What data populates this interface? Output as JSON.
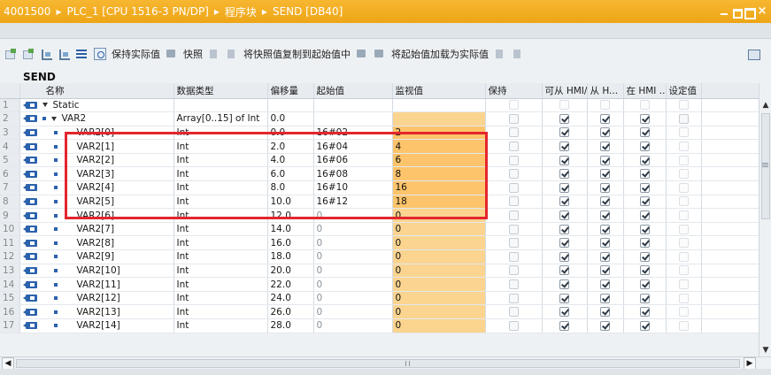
{
  "title": {
    "project": "4001500",
    "device": "PLC_1 [CPU 1516-3 PN/DP]",
    "folder": "程序块",
    "block": "SEND [DB40]",
    "separator": "▸"
  },
  "toolbar": {
    "keep_actual": "保持实际值",
    "snapshot": "快照",
    "copy_snapshot": "将快照值复制到起始值中",
    "load_start": "将起始值加载为实际值"
  },
  "block_name": "SEND",
  "headers": {
    "name": "名称",
    "datatype": "数据类型",
    "offset": "偏移量",
    "start": "起始值",
    "monitor": "监视值",
    "retain": "保持",
    "hmi_access": "可从 HMI/O...",
    "hmi_from": "从 H...",
    "hmi_in": "在 HMI ...",
    "setpoint": "设定值"
  },
  "rows": [
    {
      "num": "1",
      "kind": "static",
      "name": "Static",
      "datatype": "",
      "offset": "",
      "start": "",
      "monitor": "",
      "retain": "faint",
      "hmi": [
        "faint",
        "faint",
        "faint"
      ],
      "setpoint": "faint"
    },
    {
      "num": "2",
      "kind": "array",
      "name": "VAR2",
      "datatype": "Array[0..15] of Int",
      "offset": "0.0",
      "start": "",
      "monitor": "",
      "retain": "off",
      "hmi": [
        "on",
        "on",
        "on"
      ],
      "setpoint": "off"
    },
    {
      "num": "3",
      "kind": "elem",
      "name": "VAR2[0]",
      "datatype": "Int",
      "offset": "0.0",
      "start": "16#02",
      "monitor": "2",
      "retain": "off",
      "hmi": [
        "on",
        "on",
        "on"
      ],
      "setpoint": "faint"
    },
    {
      "num": "4",
      "kind": "elem",
      "name": "VAR2[1]",
      "datatype": "Int",
      "offset": "2.0",
      "start": "16#04",
      "monitor": "4",
      "retain": "off",
      "hmi": [
        "on",
        "on",
        "on"
      ],
      "setpoint": "faint"
    },
    {
      "num": "5",
      "kind": "elem",
      "name": "VAR2[2]",
      "datatype": "Int",
      "offset": "4.0",
      "start": "16#06",
      "monitor": "6",
      "retain": "off",
      "hmi": [
        "on",
        "on",
        "on"
      ],
      "setpoint": "faint"
    },
    {
      "num": "6",
      "kind": "elem",
      "name": "VAR2[3]",
      "datatype": "Int",
      "offset": "6.0",
      "start": "16#08",
      "monitor": "8",
      "retain": "off",
      "hmi": [
        "on",
        "on",
        "on"
      ],
      "setpoint": "faint"
    },
    {
      "num": "7",
      "kind": "elem",
      "name": "VAR2[4]",
      "datatype": "Int",
      "offset": "8.0",
      "start": "16#10",
      "monitor": "16",
      "retain": "off",
      "hmi": [
        "on",
        "on",
        "on"
      ],
      "setpoint": "faint"
    },
    {
      "num": "8",
      "kind": "elem",
      "name": "VAR2[5]",
      "datatype": "Int",
      "offset": "10.0",
      "start": "16#12",
      "monitor": "18",
      "retain": "off",
      "hmi": [
        "on",
        "on",
        "on"
      ],
      "setpoint": "faint"
    },
    {
      "num": "9",
      "kind": "elem",
      "name": "VAR2[6]",
      "datatype": "Int",
      "offset": "12.0",
      "start": "0",
      "monitor": "0",
      "retain": "off",
      "hmi": [
        "on",
        "on",
        "on"
      ],
      "setpoint": "faint"
    },
    {
      "num": "10",
      "kind": "elem",
      "name": "VAR2[7]",
      "datatype": "Int",
      "offset": "14.0",
      "start": "0",
      "monitor": "0",
      "retain": "off",
      "hmi": [
        "on",
        "on",
        "on"
      ],
      "setpoint": "faint"
    },
    {
      "num": "11",
      "kind": "elem",
      "name": "VAR2[8]",
      "datatype": "Int",
      "offset": "16.0",
      "start": "0",
      "monitor": "0",
      "retain": "off",
      "hmi": [
        "on",
        "on",
        "on"
      ],
      "setpoint": "faint"
    },
    {
      "num": "12",
      "kind": "elem",
      "name": "VAR2[9]",
      "datatype": "Int",
      "offset": "18.0",
      "start": "0",
      "monitor": "0",
      "retain": "off",
      "hmi": [
        "on",
        "on",
        "on"
      ],
      "setpoint": "faint"
    },
    {
      "num": "13",
      "kind": "elem",
      "name": "VAR2[10]",
      "datatype": "Int",
      "offset": "20.0",
      "start": "0",
      "monitor": "0",
      "retain": "off",
      "hmi": [
        "on",
        "on",
        "on"
      ],
      "setpoint": "faint"
    },
    {
      "num": "14",
      "kind": "elem",
      "name": "VAR2[11]",
      "datatype": "Int",
      "offset": "22.0",
      "start": "0",
      "monitor": "0",
      "retain": "off",
      "hmi": [
        "on",
        "on",
        "on"
      ],
      "setpoint": "faint"
    },
    {
      "num": "15",
      "kind": "elem",
      "name": "VAR2[12]",
      "datatype": "Int",
      "offset": "24.0",
      "start": "0",
      "monitor": "0",
      "retain": "off",
      "hmi": [
        "on",
        "on",
        "on"
      ],
      "setpoint": "faint"
    },
    {
      "num": "16",
      "kind": "elem",
      "name": "VAR2[13]",
      "datatype": "Int",
      "offset": "26.0",
      "start": "0",
      "monitor": "0",
      "retain": "off",
      "hmi": [
        "on",
        "on",
        "on"
      ],
      "setpoint": "faint"
    },
    {
      "num": "17",
      "kind": "elem",
      "name": "VAR2[14]",
      "datatype": "Int",
      "offset": "28.0",
      "start": "0",
      "monitor": "0",
      "retain": "off",
      "hmi": [
        "on",
        "on",
        "on"
      ],
      "setpoint": "faint"
    }
  ],
  "colors": {
    "titlebar": "#f0a91c",
    "monitor_cell": "#fbd48f",
    "highlight_box": "#e3262d",
    "accent_blue": "#2b62ad"
  },
  "icons": {
    "db_var": "db-variable-icon",
    "expand": "expand-triangle-icon",
    "element": "element-bullet-icon"
  }
}
